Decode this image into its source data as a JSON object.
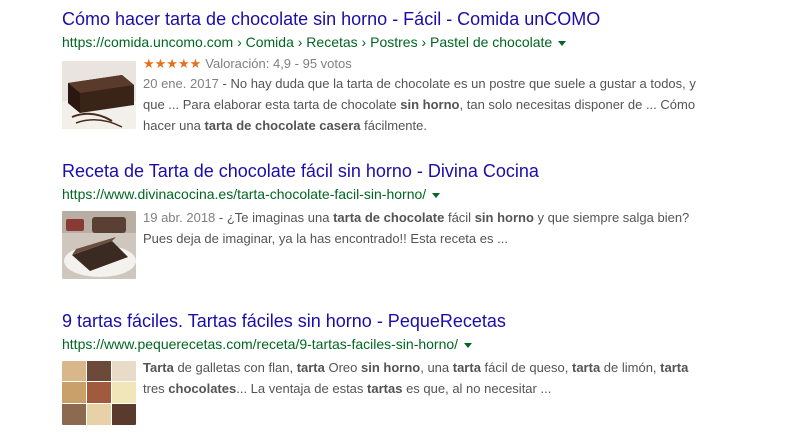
{
  "results": [
    {
      "title": "Cómo hacer tarta de chocolate sin horno - Fácil - Comida unCOMO",
      "url": "https://comida.uncomo.com › Comida › Recetas › Postres › Pastel de chocolate",
      "stars": "★★★★★",
      "rating_text": "Valoración: 4,9 - 95 votos",
      "date": "20 ene. 2017",
      "snippet": [
        {
          "t": " - No hay duda que la tarta de chocolate es un postre que suele a gustar a todos, y que ... Para elaborar esta tarta de chocolate ",
          "b": false
        },
        {
          "t": "sin horno",
          "b": true
        },
        {
          "t": ", tan solo necesitas disponer de ... Cómo hacer una ",
          "b": false
        },
        {
          "t": "tarta de chocolate casera",
          "b": true
        },
        {
          "t": " fácilmente.",
          "b": false
        }
      ]
    },
    {
      "title": "Receta de Tarta de chocolate fácil sin horno - Divina Cocina",
      "url": "https://www.divinacocina.es/tarta-chocolate-facil-sin-horno/",
      "date": "19 abr. 2018",
      "snippet": [
        {
          "t": " - ¿Te imaginas una ",
          "b": false
        },
        {
          "t": "tarta de chocolate",
          "b": true
        },
        {
          "t": " fácil ",
          "b": false
        },
        {
          "t": "sin horno",
          "b": true
        },
        {
          "t": " y que siempre salga bien? Pues deja de imaginar, ya la has encontrado!! Esta receta es ...",
          "b": false
        }
      ]
    },
    {
      "title": "9 tartas fáciles. Tartas fáciles sin horno - PequeRecetas",
      "url": "https://www.pequerecetas.com/receta/9-tartas-faciles-sin-horno/",
      "date": "",
      "snippet": [
        {
          "t": "Tarta",
          "b": true
        },
        {
          "t": " de galletas con flan, ",
          "b": false
        },
        {
          "t": "tarta",
          "b": true
        },
        {
          "t": " Oreo ",
          "b": false
        },
        {
          "t": "sin horno",
          "b": true
        },
        {
          "t": ", una ",
          "b": false
        },
        {
          "t": "tarta",
          "b": true
        },
        {
          "t": " fácil de queso, ",
          "b": false
        },
        {
          "t": "tarta",
          "b": true
        },
        {
          "t": " de limón, ",
          "b": false
        },
        {
          "t": "tarta",
          "b": true
        },
        {
          "t": " tres ",
          "b": false
        },
        {
          "t": "chocolates",
          "b": true
        },
        {
          "t": "... La ventaja de estas ",
          "b": false
        },
        {
          "t": "tartas",
          "b": true
        },
        {
          "t": " es que, al no necesitar ...",
          "b": false
        }
      ]
    }
  ],
  "colors": {
    "title": "#1a0dab",
    "url": "#006621",
    "snippet": "#545454",
    "stars": "#e7711b"
  }
}
